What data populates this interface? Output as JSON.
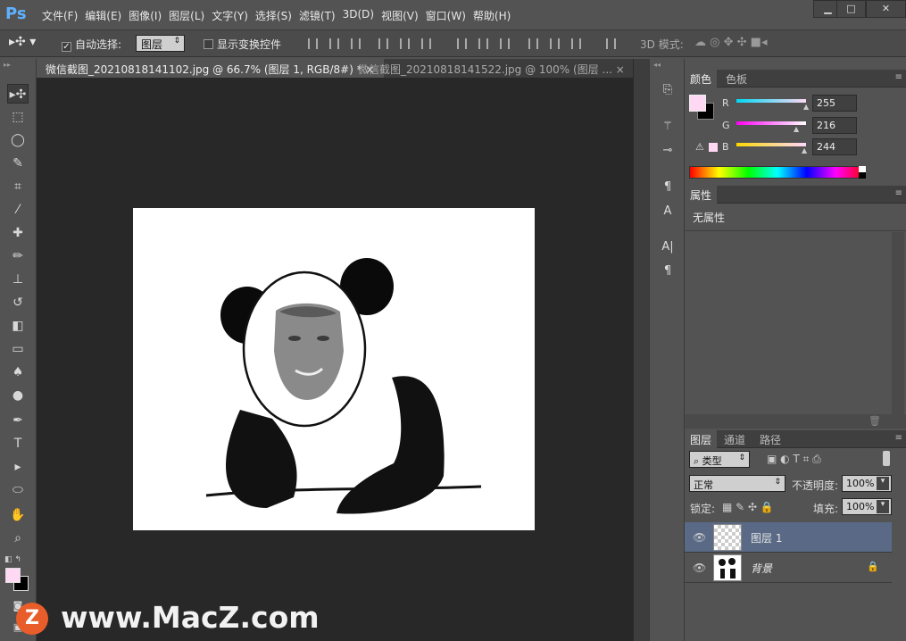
{
  "app": {
    "logo": "Ps"
  },
  "menu": [
    "文件(F)",
    "编辑(E)",
    "图像(I)",
    "图层(L)",
    "文字(Y)",
    "选择(S)",
    "滤镜(T)",
    "3D(D)",
    "视图(V)",
    "窗口(W)",
    "帮助(H)"
  ],
  "window_controls": [
    "▁",
    "□",
    "✕"
  ],
  "options": {
    "auto_select_label": "自动选择:",
    "auto_select_value": "图层",
    "show_transform_label": "显示变换控件",
    "mode_3d_label": "3D 模式:"
  },
  "tabs": [
    {
      "label": "微信截图_20210818141102.jpg @ 66.7% (图层 1, RGB/8#) *",
      "close": "×"
    },
    {
      "label": "微信截图_20210818141522.jpg @ 100% (图层 ...",
      "close": "×"
    }
  ],
  "color_panel": {
    "tabs": [
      "颜色",
      "色板"
    ],
    "channels": [
      {
        "name": "R",
        "value": "255",
        "level": 1.0
      },
      {
        "name": "G",
        "value": "216",
        "level": 0.847
      },
      {
        "name": "B",
        "value": "244",
        "level": 0.957
      }
    ],
    "foreground": "#ffd8f4",
    "background": "#000000"
  },
  "properties_panel": {
    "tab": "属性",
    "content": "无属性"
  },
  "layers_panel": {
    "tabs": [
      "图层",
      "通道",
      "路径"
    ],
    "filter_label": "类型",
    "blend_mode": "正常",
    "opacity_label": "不透明度:",
    "opacity_value": "100%",
    "lock_label": "锁定:",
    "fill_label": "填充:",
    "fill_value": "100%",
    "layers": [
      {
        "name": "图层 1",
        "selected": true
      },
      {
        "name": "背景",
        "selected": false
      }
    ]
  },
  "watermark": {
    "logo": "Z",
    "text": "www.MacZ.com"
  },
  "colors": {
    "accent_blue": "#5fb1ff",
    "selected_layer": "#5a6a86",
    "watermark_logo": "#e85d2a"
  }
}
